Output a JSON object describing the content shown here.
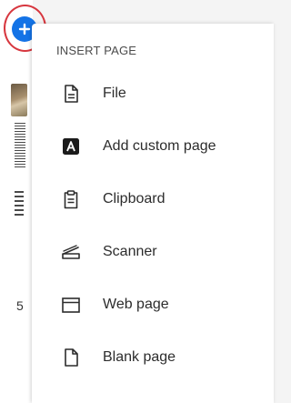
{
  "menu": {
    "heading": "INSERT PAGE",
    "items": [
      {
        "label": "File",
        "icon": "file-icon"
      },
      {
        "label": "Add custom page",
        "icon": "custom-page-icon"
      },
      {
        "label": "Clipboard",
        "icon": "clipboard-icon"
      },
      {
        "label": "Scanner",
        "icon": "scanner-icon"
      },
      {
        "label": "Web page",
        "icon": "web-page-icon"
      },
      {
        "label": "Blank page",
        "icon": "blank-page-icon"
      }
    ]
  },
  "background": {
    "partial_char": "5"
  },
  "colors": {
    "accent": "#1473e6",
    "highlight_ring": "#d7373f"
  }
}
